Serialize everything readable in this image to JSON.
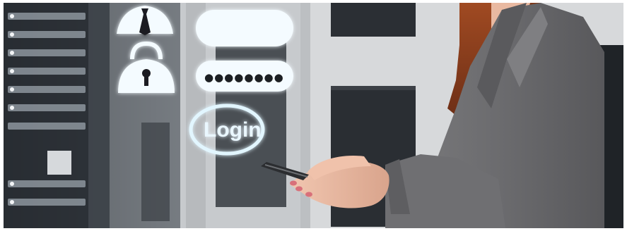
{
  "hud": {
    "login_label": "Login",
    "password_mask": "●●●●●●●●"
  },
  "colors": {
    "glow": "#bfefff",
    "panel": "#f4fbff",
    "suit": "#6a6a6c",
    "hair": "#8a3d1e",
    "server_dark": "#22272c"
  },
  "icons": [
    "user-silhouette-icon",
    "padlock-icon",
    "smartphone-icon"
  ]
}
